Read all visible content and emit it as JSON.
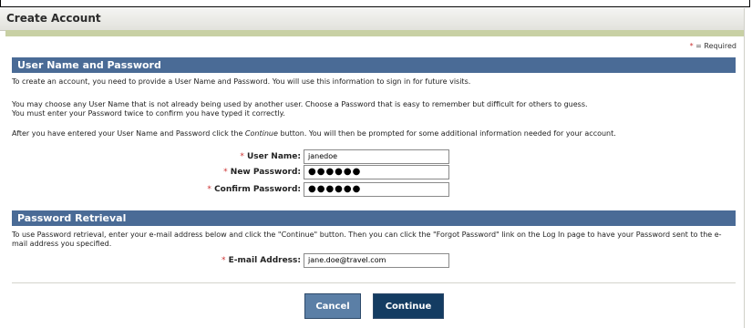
{
  "header": {
    "title": "Create Account"
  },
  "required_note": {
    "star": "*",
    "text": " = Required"
  },
  "section_account": {
    "title": "User Name and Password",
    "intro": "To create an account, you need to provide a User Name and Password. You will use this information to sign in for future visits.",
    "para2_line1": "You may choose any User Name that is not already being used by another user. Choose a Password that is easy to remember but difficult for others to guess.",
    "para2_line2": "You must enter your Password twice to confirm you have typed it correctly.",
    "para3_a": "After you have entered your User Name and Password click the ",
    "para3_em": "Continue",
    "para3_b": " button. You will then be prompted for some additional information needed for your account.",
    "fields": {
      "username": {
        "label": "User Name:",
        "value": "janedoe"
      },
      "new_password": {
        "label": "New Password:",
        "value": "●●●●●●"
      },
      "confirm_password": {
        "label": "Confirm Password:",
        "value": "●●●●●●"
      }
    }
  },
  "section_retrieval": {
    "title": "Password Retrieval",
    "text": "To use Password retrieval, enter your e-mail address below and click the \"Continue\" button. Then you can click the \"Forgot Password\" link on the Log In page to have your Password sent to the e-mail address you specified.",
    "email": {
      "label": "E-mail Address:",
      "value": "jane.doe@travel.com"
    }
  },
  "buttons": {
    "cancel": "Cancel",
    "continue": "Continue"
  },
  "colors": {
    "section_bar": "#4a6b96",
    "required_star": "#cc3333",
    "continue_button": "#143c62",
    "cancel_button": "#5b7fa6"
  }
}
